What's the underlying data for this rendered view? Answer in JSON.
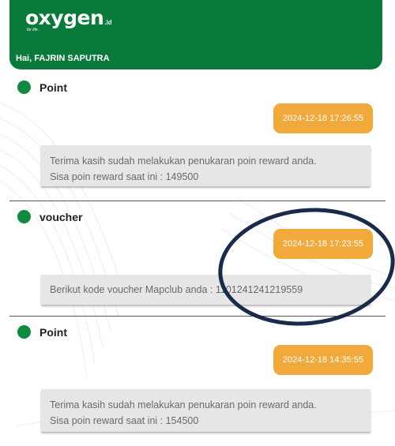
{
  "app": {
    "logo": "oxygen",
    "logo_suffix": ".id",
    "tagline": "for life.",
    "greeting": "Hai, FAJRIN SAPUTRA",
    "brand_color": "#0a7a3a",
    "accent_color": "#f2a93b"
  },
  "notifications": [
    {
      "title": "Point",
      "datetime": "2024-12-18 17:26:55",
      "message_line1": "Terima kasih sudah melakukan penukaran poin reward anda.",
      "message_line2": "Sisa poin reward saat ini : 149500"
    },
    {
      "title": "voucher",
      "datetime": "2024-12-18 17:23:55",
      "message_line1": "Berikut kode voucher Mapclub anda : 1101241241219559"
    },
    {
      "title": "Point",
      "datetime": "2024-12-18 14:35:55",
      "message_line1": "Terima kasih sudah melakukan penukaran poin reward anda.",
      "message_line2": "Sisa poin reward saat ini : 154500"
    }
  ]
}
